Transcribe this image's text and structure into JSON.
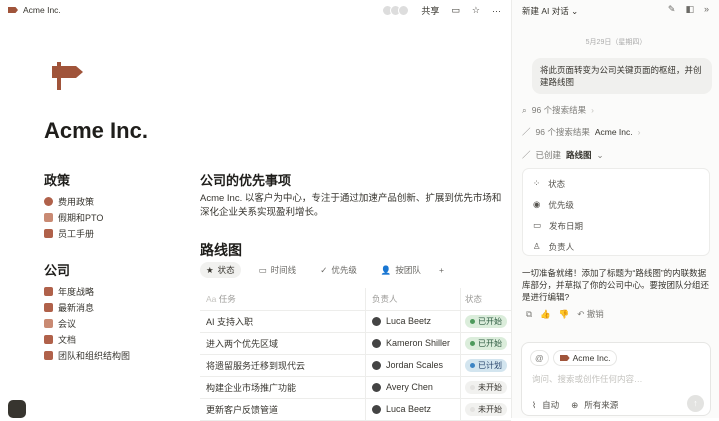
{
  "topbar": {
    "breadcrumb": "Acme Inc.",
    "share": "共享"
  },
  "page": {
    "title": "Acme Inc.",
    "policy": {
      "heading": "政策",
      "items": [
        "费用政策",
        "假期和PTO",
        "员工手册"
      ]
    },
    "company": {
      "heading": "公司",
      "items": [
        "年度战略",
        "最新消息",
        "会议",
        "文档",
        "团队和组织结构图"
      ]
    },
    "priorities": {
      "heading": "公司的优先事项",
      "text": "Acme Inc. 以客户为中心，专注于通过加速产品创新、扩展到优先市场和深化企业关系实现盈利增长。"
    },
    "roadmap": {
      "heading": "路线图",
      "tabs": [
        "状态",
        "时间线",
        "优先级",
        "按团队"
      ],
      "columns": [
        "任务",
        "负责人",
        "状态"
      ],
      "rows": [
        {
          "task": "AI 支持入职",
          "owner": "Luca Beetz",
          "status": "已开始",
          "kind": "started"
        },
        {
          "task": "进入两个优先区域",
          "owner": "Kameron Shiller",
          "status": "已开始",
          "kind": "started"
        },
        {
          "task": "将遗留服务迁移到现代云",
          "owner": "Jordan Scales",
          "status": "已计划",
          "kind": "planned"
        },
        {
          "task": "构建企业市场推广功能",
          "owner": "Avery Chen",
          "status": "未开始",
          "kind": "none"
        },
        {
          "task": "更新客户反馈管道",
          "owner": "Luca Beetz",
          "status": "未开始",
          "kind": "none"
        }
      ]
    }
  },
  "chat": {
    "title": "新建 AI 对话",
    "date": "5月29日（星期四）",
    "user_msg": "将此页面转变为公司关键页面的枢纽，并创建路线图",
    "step1": "96 个搜索结果",
    "step2_a": "96 个搜索结果",
    "step2_b": "Acme Inc.",
    "step3_a": "已创建",
    "step3_b": "路线图",
    "props": [
      "状态",
      "优先级",
      "发布日期",
      "负责人"
    ],
    "reply": "一切准备就绪！添加了标题为“路线图”的内联数据库部分，并草拟了你的公司中心。要按团队分组还是进行编辑?",
    "undo": "撤销",
    "mention": "Acme Inc.",
    "placeholder": "询问、搜索或创作任何内容…",
    "mode": "自动",
    "sources": "所有来源"
  },
  "colors": {
    "brand": "#a0543a",
    "started_bg": "#dbeddb",
    "planned_bg": "#d3e5ef",
    "none_bg": "#f1f1ef"
  }
}
